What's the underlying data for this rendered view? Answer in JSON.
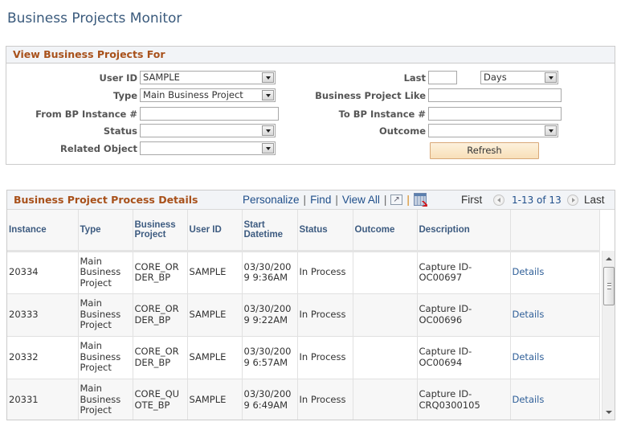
{
  "page": {
    "title": "Business Projects Monitor"
  },
  "search_panel": {
    "title": "View Business Projects For",
    "fields": {
      "user_id": {
        "label": "User ID",
        "value": "SAMPLE"
      },
      "type": {
        "label": "Type",
        "value": "Main Business Project"
      },
      "from_bp_instance": {
        "label": "From BP Instance #",
        "value": ""
      },
      "status": {
        "label": "Status",
        "value": ""
      },
      "related_object": {
        "label": "Related Object",
        "value": ""
      },
      "last": {
        "label": "Last",
        "value": "",
        "unit": "Days"
      },
      "business_project_like": {
        "label": "Business Project Like",
        "value": ""
      },
      "to_bp_instance": {
        "label": "To BP Instance #",
        "value": ""
      },
      "outcome": {
        "label": "Outcome",
        "value": ""
      }
    },
    "refresh_label": "Refresh"
  },
  "grid": {
    "title": "Business Project Process Details",
    "toolbar": {
      "personalize": "Personalize",
      "find": "Find",
      "view_all": "View All",
      "sep": "|",
      "first": "First",
      "range": "1-13 of 13",
      "last": "Last"
    },
    "columns": [
      "Instance",
      "Type",
      "Business Project",
      "User ID",
      "Start Datetime",
      "Status",
      "Outcome",
      "Description",
      ""
    ],
    "rows": [
      {
        "instance": "20334",
        "type": "Main Business Project",
        "business_project": "CORE_ORDER_BP",
        "user_id": "SAMPLE",
        "start_datetime": "03/30/2009  9:36AM",
        "status": "In Process",
        "outcome": "",
        "description": "Capture ID-OC00697",
        "link": "Details"
      },
      {
        "instance": "20333",
        "type": "Main Business Project",
        "business_project": "CORE_ORDER_BP",
        "user_id": "SAMPLE",
        "start_datetime": "03/30/2009  9:22AM",
        "status": "In Process",
        "outcome": "",
        "description": "Capture ID-OC00696",
        "link": "Details"
      },
      {
        "instance": "20332",
        "type": "Main Business Project",
        "business_project": "CORE_ORDER_BP",
        "user_id": "SAMPLE",
        "start_datetime": "03/30/2009  6:57AM",
        "status": "In Process",
        "outcome": "",
        "description": "Capture ID-OC00694",
        "link": "Details"
      },
      {
        "instance": "20331",
        "type": "Main Business Project",
        "business_project": "CORE_QUOTE_BP",
        "user_id": "SAMPLE",
        "start_datetime": "03/30/2009  6:49AM",
        "status": "In Process",
        "outcome": "",
        "description": "Capture ID-CRQ0300105",
        "link": "Details"
      }
    ]
  },
  "colors": {
    "section_title": "#a8511b",
    "page_title": "#3a5a7c",
    "link": "#1f4e8a"
  }
}
